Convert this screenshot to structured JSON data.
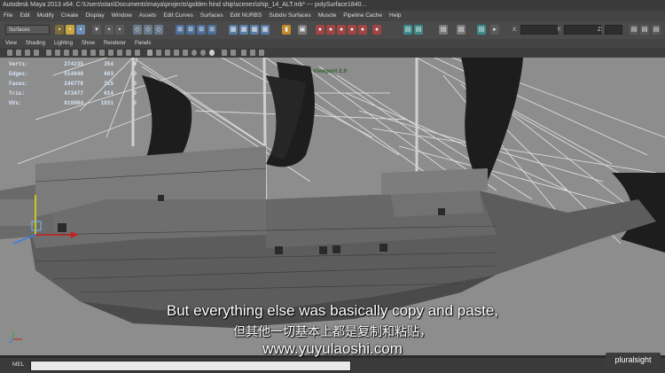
{
  "window": {
    "title": "Autodesk Maya 2013 x64: C:\\Users\\stas\\Documents\\maya\\projects\\golden hind ship\\scenes\\ship_14_ALT.mb*  ---  polySurface1840..."
  },
  "menu": [
    "File",
    "Edit",
    "Modify",
    "Create",
    "Display",
    "Window",
    "Assets",
    "Edit Curves",
    "Surfaces",
    "Edit NURBS",
    "Subdiv Surfaces",
    "Muscle",
    "Pipeline Cache",
    "Help"
  ],
  "shelf": {
    "mode": "Surfaces",
    "coord_x": "X:",
    "coord_y": "Y:",
    "coord_z": "Z:"
  },
  "panel_menu": [
    "View",
    "Shading",
    "Lighting",
    "Show",
    "Renderer",
    "Panels"
  ],
  "hud": {
    "rows": [
      {
        "label": "Verts:",
        "v1": "274235",
        "v2": "354",
        "v3": "0"
      },
      {
        "label": "Edges:",
        "v1": "514848",
        "v2": "663",
        "v3": "0"
      },
      {
        "label": "Faces:",
        "v1": "246778",
        "v2": "315",
        "v3": "0"
      },
      {
        "label": "Tris:",
        "v1": "473477",
        "v2": "614",
        "v3": "0"
      },
      {
        "label": "UVs:",
        "v1": "819984",
        "v2": "1031",
        "v3": "0"
      }
    ],
    "viewport_label": "Viewport 2.0"
  },
  "subtitles": {
    "english": "But everything else was basically copy and paste,",
    "chinese": "但其他一切基本上都是复制和粘贴，",
    "url": "www.yuyulaoshi.com"
  },
  "status": {
    "mel_label": "MEL"
  },
  "brand": {
    "logo_text": "pluralsight"
  },
  "colors": {
    "viewport_bg": "#8d8d8d",
    "hull": "#5c5c5c",
    "sail": "#1d1d1d",
    "rigging": "#e0e0e0"
  }
}
